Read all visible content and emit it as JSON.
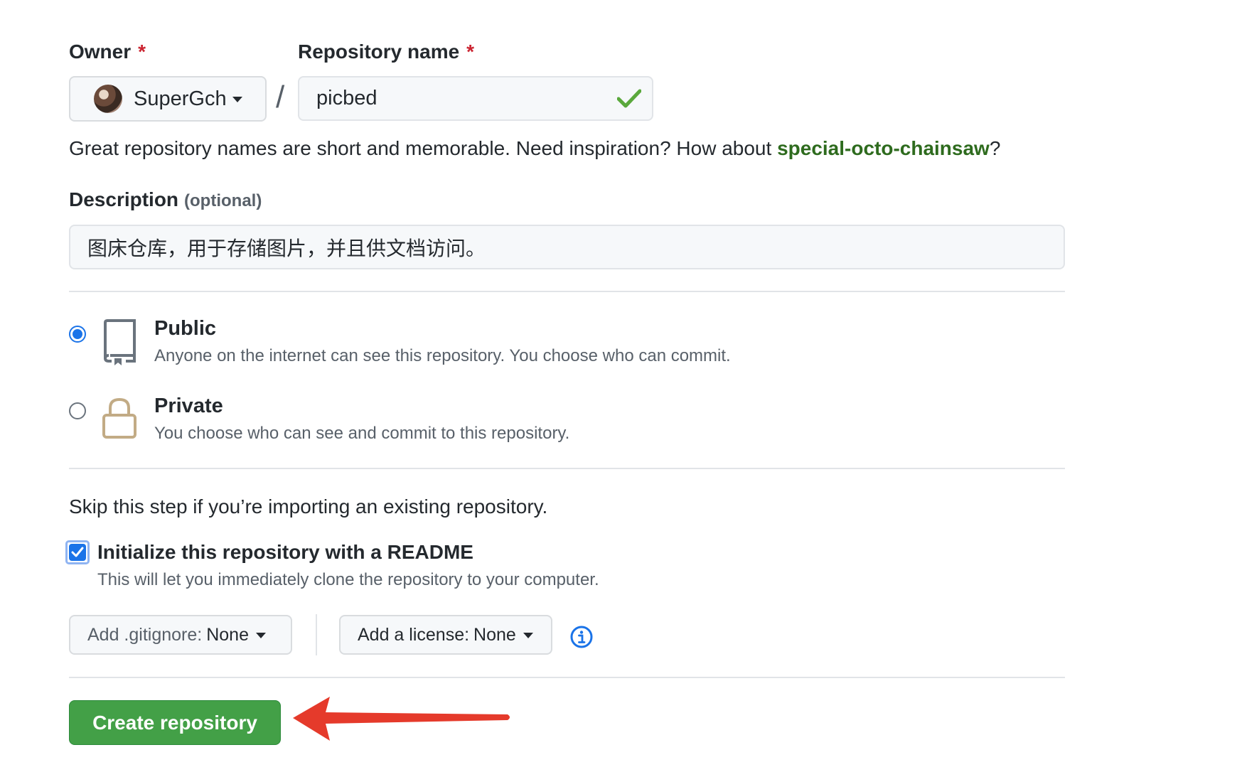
{
  "owner": {
    "label": "Owner",
    "required_mark": "*",
    "value": "SuperGch"
  },
  "repo": {
    "label": "Repository name",
    "required_mark": "*",
    "value": "picbed",
    "valid_icon": "check-icon"
  },
  "separator": "/",
  "hint": {
    "prefix": "Great repository names are short and memorable. Need inspiration? How about ",
    "suggestion": "special-octo-chainsaw",
    "suffix": "?"
  },
  "description": {
    "label": "Description",
    "optional": "(optional)",
    "value": "图床仓库，用于存储图片，并且供文档访问。"
  },
  "visibility": {
    "selected": "public",
    "public": {
      "title": "Public",
      "desc": "Anyone on the internet can see this repository. You choose who can commit.",
      "icon": "repo-icon"
    },
    "private": {
      "title": "Private",
      "desc": "You choose who can see and commit to this repository.",
      "icon": "lock-icon"
    }
  },
  "init": {
    "skip_text": "Skip this step if you’re importing an existing repository.",
    "readme_title": "Initialize this repository with a README",
    "readme_desc": "This will let you immediately clone the repository to your computer.",
    "readme_checked": true
  },
  "gitignore": {
    "prefix": "Add .gitignore:",
    "value": "None"
  },
  "license": {
    "prefix": "Add a license:",
    "value": "None"
  },
  "submit": {
    "label": "Create repository",
    "color": "#43a047"
  },
  "colors": {
    "accent_blue": "#1a73e8",
    "required_red": "#cb2431",
    "annotation_arrow": "#e53a2b"
  }
}
